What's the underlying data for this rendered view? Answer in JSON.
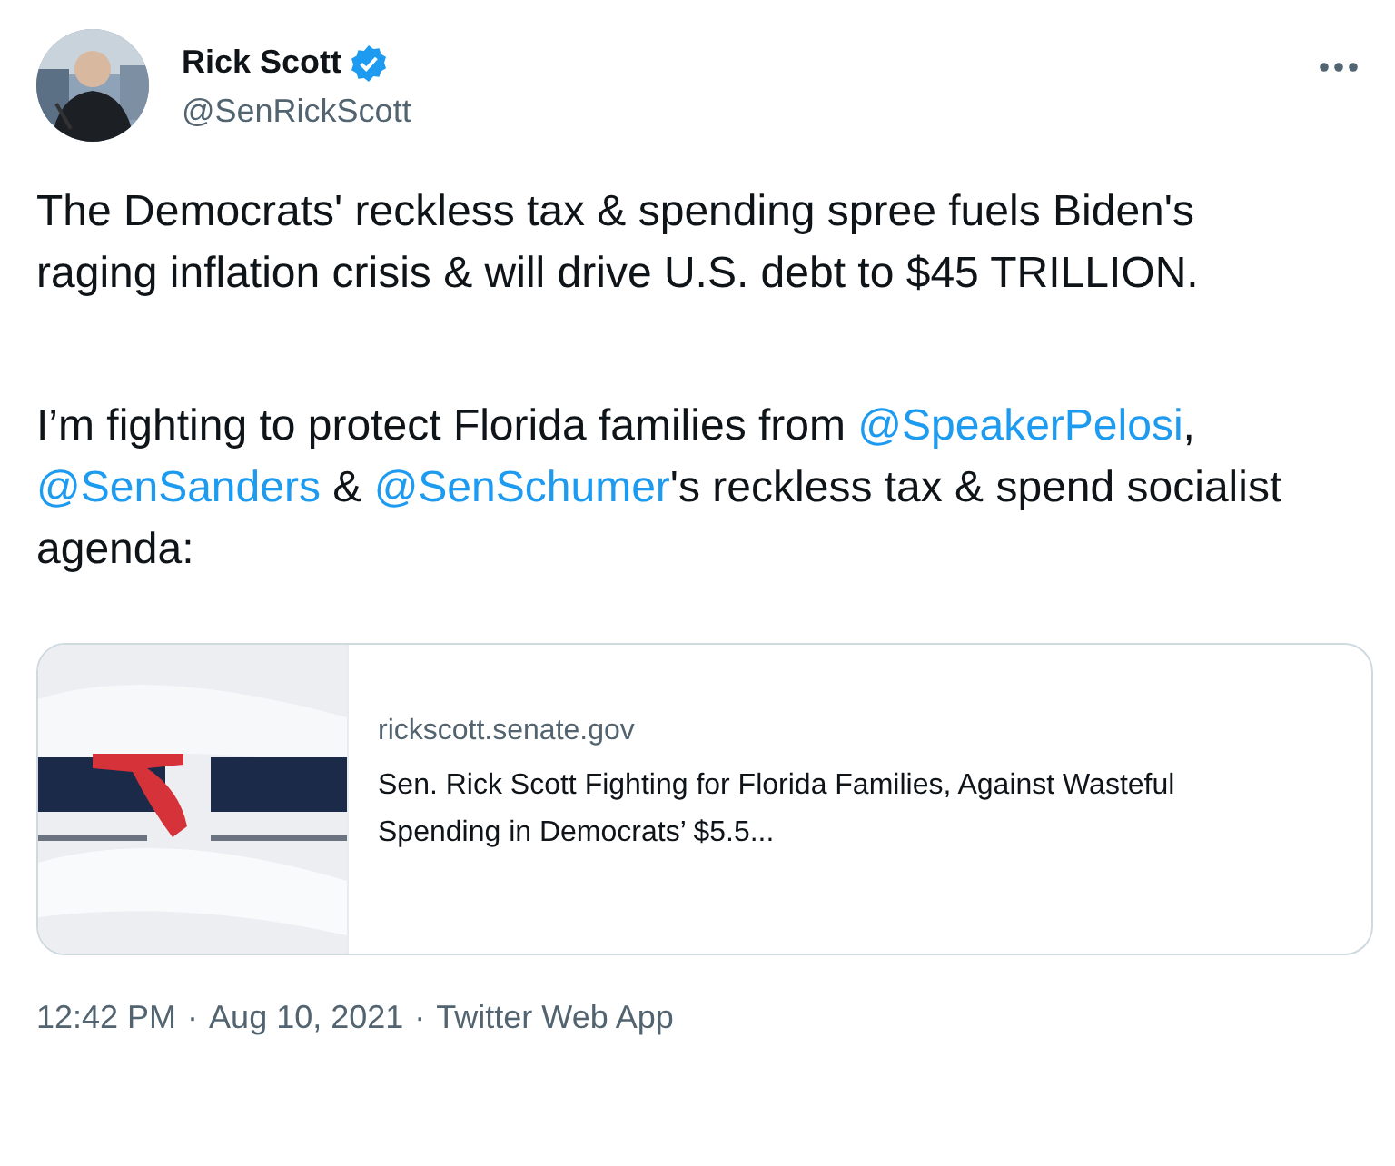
{
  "author": {
    "name": "Rick Scott",
    "verified": true,
    "handle": "@SenRickScott"
  },
  "paragraphs": [
    [
      {
        "kind": "text",
        "text": "The Democrats' reckless tax & spending spree fuels Biden's raging inflation crisis & will drive U.S. debt to $45 TRILLION."
      }
    ],
    [
      {
        "kind": "text",
        "text": "I’m fighting to protect Florida families from "
      },
      {
        "kind": "mention",
        "text": "@SpeakerPelosi"
      },
      {
        "kind": "text",
        "text": ", "
      },
      {
        "kind": "mention",
        "text": "@SenSanders"
      },
      {
        "kind": "text",
        "text": " & "
      },
      {
        "kind": "mention",
        "text": "@SenSchumer"
      },
      {
        "kind": "text",
        "text": "'s reckless tax & spend socialist agenda:"
      }
    ]
  ],
  "link_card": {
    "domain": "rickscott.senate.gov",
    "title": "Sen. Rick Scott Fighting for Florida Families, Against Wasteful Spending in Democrats’ $5.5..."
  },
  "footer": {
    "time": "12:42 PM",
    "separator_1": "·",
    "date": "Aug 10, 2021",
    "separator_2": "·",
    "source": "Twitter Web App"
  }
}
